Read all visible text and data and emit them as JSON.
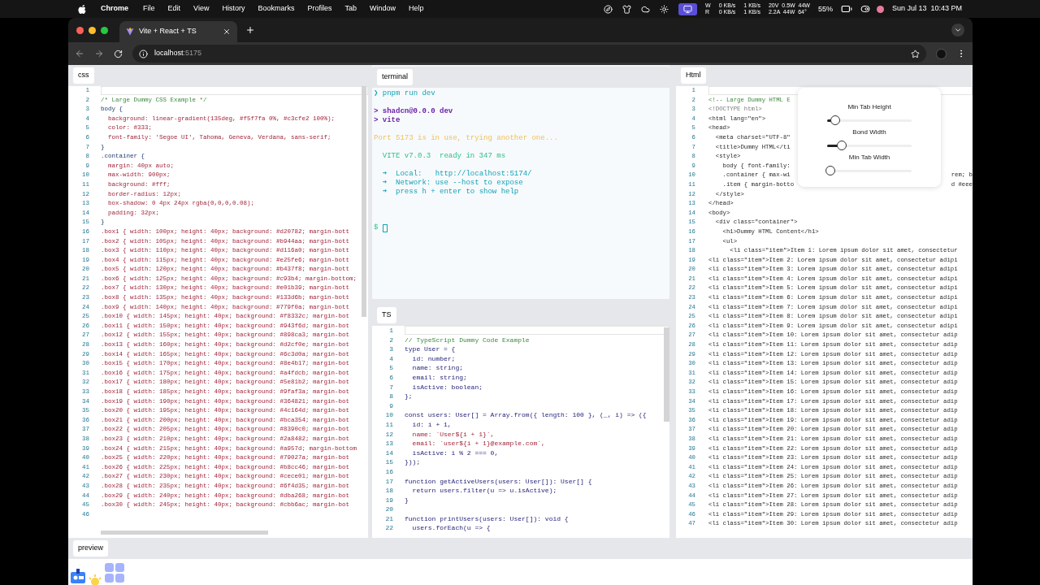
{
  "menubar": {
    "app": "Chrome",
    "items": [
      "File",
      "Edit",
      "View",
      "History",
      "Bookmarks",
      "Profiles",
      "Tab",
      "Window",
      "Help"
    ],
    "status": [
      {
        "kind": "stack",
        "lines": [
          "W",
          "R"
        ]
      },
      {
        "kind": "stack",
        "lines": [
          "0 KB/s",
          "0 KB/s"
        ]
      },
      {
        "kind": "stack",
        "lines": [
          "1 KB/s",
          "1 KB/s"
        ]
      },
      {
        "kind": "stack",
        "lines": [
          "20V  0.5W  44W",
          "2.2A  44W  64°"
        ]
      },
      {
        "kind": "text",
        "lines": [
          "55%"
        ]
      }
    ],
    "clock": "Sun Jul 13  10:43 PM"
  },
  "browser": {
    "tab_title": "Vite + React + TS",
    "url_host": "localhost",
    "url_port": ":5175"
  },
  "css_panel": {
    "tab": "css",
    "lines": [
      {
        "n": "1",
        "kind": "blank"
      },
      {
        "n": "2",
        "kind": "comment",
        "text": "/* Large Dummy CSS Example */"
      },
      {
        "n": "3",
        "kind": "selector",
        "text": "body {"
      },
      {
        "n": "4",
        "kind": "prop",
        "text": "  background: linear-gradient(135deg, #f5f7fa 0%, #c3cfe2 100%);"
      },
      {
        "n": "5",
        "kind": "prop",
        "text": "  color: #333;"
      },
      {
        "n": "6",
        "kind": "prop",
        "text": "  font-family: 'Segoe UI', Tahoma, Geneva, Verdana, sans-serif;"
      },
      {
        "n": "7",
        "kind": "selector",
        "text": "}"
      },
      {
        "n": "8",
        "kind": "selector",
        "text": ".container {"
      },
      {
        "n": "9",
        "kind": "prop",
        "text": "  margin: 40px auto;"
      },
      {
        "n": "10",
        "kind": "prop",
        "text": "  max-width: 900px;"
      },
      {
        "n": "11",
        "kind": "prop",
        "text": "  background: #fff;"
      },
      {
        "n": "12",
        "kind": "prop",
        "text": "  border-radius: 12px;"
      },
      {
        "n": "13",
        "kind": "prop",
        "text": "  box-shadow: 0 4px 24px rgba(0,0,0,0.08);"
      },
      {
        "n": "14",
        "kind": "prop",
        "text": "  padding: 32px;"
      },
      {
        "n": "15",
        "kind": "selector",
        "text": "}"
      },
      {
        "n": "16",
        "kind": "rule",
        "text": ".box1 { width: 100px; height: 40px; background: #d20782; margin-bott"
      },
      {
        "n": "17",
        "kind": "rule",
        "text": ".box2 { width: 105px; height: 40px; background: #b944aa; margin-bott"
      },
      {
        "n": "18",
        "kind": "rule",
        "text": ".box3 { width: 110px; height: 40px; background: #d116a0; margin-bott"
      },
      {
        "n": "19",
        "kind": "rule",
        "text": ".box4 { width: 115px; height: 40px; background: #e25fe6; margin-bott"
      },
      {
        "n": "20",
        "kind": "rule",
        "text": ".box5 { width: 120px; height: 40px; background: #b437f8; margin-bott"
      },
      {
        "n": "21",
        "kind": "rule",
        "text": ".box6 { width: 125px; height: 40px; background: #c93b4; margin-bottom;"
      },
      {
        "n": "22",
        "kind": "rule",
        "text": ".box7 { width: 130px; height: 40px; background: #e01b39; margin-bott"
      },
      {
        "n": "23",
        "kind": "rule",
        "text": ".box8 { width: 135px; height: 40px; background: #133d6b; margin-bott"
      },
      {
        "n": "24",
        "kind": "rule",
        "text": ".box9 { width: 140px; height: 40px; background: #779f0a; margin-bott"
      },
      {
        "n": "25",
        "kind": "rule",
        "text": ".box10 { width: 145px; height: 40px; background: #f8332c; margin-bot"
      },
      {
        "n": "26",
        "kind": "rule",
        "text": ".box11 { width: 150px; height: 40px; background: #943f6d; margin-bot"
      },
      {
        "n": "27",
        "kind": "rule",
        "text": ".box12 { width: 155px; height: 40px; background: #898ca3; margin-bot"
      },
      {
        "n": "28",
        "kind": "rule",
        "text": ".box13 { width: 160px; height: 40px; background: #d2cf0e; margin-bot"
      },
      {
        "n": "29",
        "kind": "rule",
        "text": ".box14 { width: 165px; height: 40px; background: #6c3d0a; margin-bot"
      },
      {
        "n": "30",
        "kind": "rule",
        "text": ".box15 { width: 170px; height: 40px; background: #8e4b17; margin-bot"
      },
      {
        "n": "31",
        "kind": "rule",
        "text": ".box16 { width: 175px; height: 40px; background: #a4fdcb; margin-bot"
      },
      {
        "n": "32",
        "kind": "rule",
        "text": ".box17 { width: 180px; height: 40px; background: #5e81b2; margin-bot"
      },
      {
        "n": "33",
        "kind": "rule",
        "text": ".box18 { width: 185px; height: 40px; background: #9faf3a; margin-bot"
      },
      {
        "n": "34",
        "kind": "rule",
        "text": ".box19 { width: 190px; height: 40px; background: #364821; margin-bot"
      },
      {
        "n": "35",
        "kind": "rule",
        "text": ".box20 { width: 195px; height: 40px; background: #4c164d; margin-bot"
      },
      {
        "n": "36",
        "kind": "rule",
        "text": ".box21 { width: 200px; height: 40px; background: #bca354; margin-bot"
      },
      {
        "n": "37",
        "kind": "rule",
        "text": ".box22 { width: 205px; height: 40px; background: #8390c0; margin-bot"
      },
      {
        "n": "38",
        "kind": "rule",
        "text": ".box23 { width: 210px; height: 40px; background: #2a8482; margin-bot"
      },
      {
        "n": "39",
        "kind": "rule",
        "text": ".box24 { width: 215px; height: 40px; background: #a957d; margin-bottom"
      },
      {
        "n": "40",
        "kind": "rule",
        "text": ".box25 { width: 220px; height: 40px; background: #79027a; margin-bot"
      },
      {
        "n": "41",
        "kind": "rule",
        "text": ".box26 { width: 225px; height: 40px; background: #b8cc46; margin-bot"
      },
      {
        "n": "42",
        "kind": "rule",
        "text": ".box27 { width: 230px; height: 40px; background: #cece01; margin-bot"
      },
      {
        "n": "43",
        "kind": "rule",
        "text": ".box28 { width: 235px; height: 40px; background: #6f4d35; margin-bot"
      },
      {
        "n": "44",
        "kind": "rule",
        "text": ".box29 { width: 240px; height: 40px; background: #dba268; margin-bot"
      },
      {
        "n": "45",
        "kind": "rule",
        "text": ".box30 { width: 245px; height: 40px; background: #cbb6ac; margin-bot"
      },
      {
        "n": "46",
        "kind": "blank"
      }
    ]
  },
  "terminal_panel": {
    "tab": "terminal",
    "lines": [
      {
        "kind": "prompt",
        "text": "❯ pnpm run dev"
      },
      {
        "kind": "blank"
      },
      {
        "kind": "script",
        "text": "> shadcn@0.0.0 dev"
      },
      {
        "kind": "script",
        "text": "> vite"
      },
      {
        "kind": "blank"
      },
      {
        "kind": "warn",
        "text": "Port 5173 is in use, trying another one..."
      },
      {
        "kind": "blank"
      },
      {
        "kind": "vite",
        "text": "  VITE v7.0.3  ready in 347 ms"
      },
      {
        "kind": "blank"
      },
      {
        "kind": "info",
        "text": "  ➜  Local:   http://localhost:5174/"
      },
      {
        "kind": "info",
        "text": "  ➜  Network: use --host to expose"
      },
      {
        "kind": "info",
        "text": "  ➜  press h + enter to show help"
      },
      {
        "kind": "blank"
      },
      {
        "kind": "blank"
      },
      {
        "kind": "blank"
      },
      {
        "kind": "shell",
        "text": "$"
      }
    ]
  },
  "ts_panel": {
    "tab": "TS",
    "lines": [
      {
        "n": "1",
        "kind": "blank"
      },
      {
        "n": "2",
        "kind": "comment",
        "text": "// TypeScript Dummy Code Example"
      },
      {
        "n": "3",
        "kind": "code",
        "text": "type User = {"
      },
      {
        "n": "4",
        "kind": "code",
        "text": "  id: number;"
      },
      {
        "n": "5",
        "kind": "code",
        "text": "  name: string;"
      },
      {
        "n": "6",
        "kind": "code",
        "text": "  email: string;"
      },
      {
        "n": "7",
        "kind": "code",
        "text": "  isActive: boolean;"
      },
      {
        "n": "8",
        "kind": "code",
        "text": "};"
      },
      {
        "n": "9",
        "kind": "blank"
      },
      {
        "n": "10",
        "kind": "code",
        "text": "const users: User[] = Array.from({ length: 100 }, (_, i) => ({"
      },
      {
        "n": "11",
        "kind": "code",
        "text": "  id: i + 1,"
      },
      {
        "n": "12",
        "kind": "string",
        "text": "  name: `User${i + 1}`,"
      },
      {
        "n": "13",
        "kind": "string",
        "text": "  email: `user${i + 1}@example.com`,"
      },
      {
        "n": "14",
        "kind": "code",
        "text": "  isActive: i % 2 === 0,"
      },
      {
        "n": "15",
        "kind": "code",
        "text": "}));"
      },
      {
        "n": "16",
        "kind": "blank"
      },
      {
        "n": "17",
        "kind": "code",
        "text": "function getActiveUsers(users: User[]): User[] {"
      },
      {
        "n": "18",
        "kind": "code",
        "text": "  return users.filter(u => u.isActive);"
      },
      {
        "n": "19",
        "kind": "code",
        "text": "}"
      },
      {
        "n": "20",
        "kind": "blank"
      },
      {
        "n": "21",
        "kind": "code",
        "text": "function printUsers(users: User[]): void {"
      },
      {
        "n": "22",
        "kind": "code",
        "text": "  users.forEach(u => {"
      }
    ]
  },
  "html_panel": {
    "tab": "Html",
    "lines": [
      {
        "n": "1",
        "kind": "blank"
      },
      {
        "n": "2",
        "kind": "comment",
        "text": "<!-- Large Dummy HTML E"
      },
      {
        "n": "3",
        "kind": "doctype",
        "text": "<!DOCTYPE html>"
      },
      {
        "n": "4",
        "kind": "tag",
        "text": "<html lang=\"en\">"
      },
      {
        "n": "5",
        "kind": "tag",
        "text": "<head>"
      },
      {
        "n": "6",
        "kind": "tag",
        "text": "  <meta charset=\"UTF-8\""
      },
      {
        "n": "7",
        "kind": "tag",
        "text": "  <title>Dummy HTML</ti"
      },
      {
        "n": "8",
        "kind": "tag",
        "text": "  <style>"
      },
      {
        "n": "9",
        "kind": "tag",
        "text": "    body { font-family:"
      },
      {
        "n": "10",
        "kind": "tag",
        "text": "    .container { max-wi",
        "tail": "rem; b"
      },
      {
        "n": "11",
        "kind": "tag",
        "text": "    .item { margin-botto",
        "tail": "d #eee"
      },
      {
        "n": "12",
        "kind": "tag",
        "text": "  </style>"
      },
      {
        "n": "13",
        "kind": "tag",
        "text": "</head>"
      },
      {
        "n": "14",
        "kind": "tag",
        "text": "<body>"
      },
      {
        "n": "15",
        "kind": "tag",
        "text": "  <div class=\"container\">"
      },
      {
        "n": "16",
        "kind": "tag",
        "text": "    <h1>Dummy HTML Content</h1>"
      },
      {
        "n": "17",
        "kind": "tag",
        "text": "    <ul>"
      },
      {
        "n": "18",
        "kind": "tag",
        "text": "      <li class=\"item\">Item 1: Lorem ipsum dolor sit amet, consectetur"
      },
      {
        "n": "19",
        "kind": "tag",
        "text": "<li class=\"item\">Item 2: Lorem ipsum dolor sit amet, consectetur adipi"
      },
      {
        "n": "20",
        "kind": "tag",
        "text": "<li class=\"item\">Item 3: Lorem ipsum dolor sit amet, consectetur adipi"
      },
      {
        "n": "21",
        "kind": "tag",
        "text": "<li class=\"item\">Item 4: Lorem ipsum dolor sit amet, consectetur adipi"
      },
      {
        "n": "22",
        "kind": "tag",
        "text": "<li class=\"item\">Item 5: Lorem ipsum dolor sit amet, consectetur adipi"
      },
      {
        "n": "23",
        "kind": "tag",
        "text": "<li class=\"item\">Item 6: Lorem ipsum dolor sit amet, consectetur adipi"
      },
      {
        "n": "24",
        "kind": "tag",
        "text": "<li class=\"item\">Item 7: Lorem ipsum dolor sit amet, consectetur adipi"
      },
      {
        "n": "25",
        "kind": "tag",
        "text": "<li class=\"item\">Item 8: Lorem ipsum dolor sit amet, consectetur adipi"
      },
      {
        "n": "26",
        "kind": "tag",
        "text": "<li class=\"item\">Item 9: Lorem ipsum dolor sit amet, consectetur adipi"
      },
      {
        "n": "27",
        "kind": "tag",
        "text": "<li class=\"item\">Item 10: Lorem ipsum dolor sit amet, consectetur adip"
      },
      {
        "n": "28",
        "kind": "tag",
        "text": "<li class=\"item\">Item 11: Lorem ipsum dolor sit amet, consectetur adip"
      },
      {
        "n": "29",
        "kind": "tag",
        "text": "<li class=\"item\">Item 12: Lorem ipsum dolor sit amet, consectetur adip"
      },
      {
        "n": "30",
        "kind": "tag",
        "text": "<li class=\"item\">Item 13: Lorem ipsum dolor sit amet, consectetur adip"
      },
      {
        "n": "31",
        "kind": "tag",
        "text": "<li class=\"item\">Item 14: Lorem ipsum dolor sit amet, consectetur adip"
      },
      {
        "n": "32",
        "kind": "tag",
        "text": "<li class=\"item\">Item 15: Lorem ipsum dolor sit amet, consectetur adip"
      },
      {
        "n": "33",
        "kind": "tag",
        "text": "<li class=\"item\">Item 16: Lorem ipsum dolor sit amet, consectetur adip"
      },
      {
        "n": "34",
        "kind": "tag",
        "text": "<li class=\"item\">Item 17: Lorem ipsum dolor sit amet, consectetur adip"
      },
      {
        "n": "35",
        "kind": "tag",
        "text": "<li class=\"item\">Item 18: Lorem ipsum dolor sit amet, consectetur adip"
      },
      {
        "n": "36",
        "kind": "tag",
        "text": "<li class=\"item\">Item 19: Lorem ipsum dolor sit amet, consectetur adip"
      },
      {
        "n": "37",
        "kind": "tag",
        "text": "<li class=\"item\">Item 20: Lorem ipsum dolor sit amet, consectetur adip"
      },
      {
        "n": "38",
        "kind": "tag",
        "text": "<li class=\"item\">Item 21: Lorem ipsum dolor sit amet, consectetur adip"
      },
      {
        "n": "39",
        "kind": "tag",
        "text": "<li class=\"item\">Item 22: Lorem ipsum dolor sit amet, consectetur adip"
      },
      {
        "n": "40",
        "kind": "tag",
        "text": "<li class=\"item\">Item 23: Lorem ipsum dolor sit amet, consectetur adip"
      },
      {
        "n": "41",
        "kind": "tag",
        "text": "<li class=\"item\">Item 24: Lorem ipsum dolor sit amet, consectetur adip"
      },
      {
        "n": "42",
        "kind": "tag",
        "text": "<li class=\"item\">Item 25: Lorem ipsum dolor sit amet, consectetur adip"
      },
      {
        "n": "43",
        "kind": "tag",
        "text": "<li class=\"item\">Item 26: Lorem ipsum dolor sit amet, consectetur adip"
      },
      {
        "n": "44",
        "kind": "tag",
        "text": "<li class=\"item\">Item 27: Lorem ipsum dolor sit amet, consectetur adip"
      },
      {
        "n": "45",
        "kind": "tag",
        "text": "<li class=\"item\">Item 28: Lorem ipsum dolor sit amet, consectetur adip"
      },
      {
        "n": "46",
        "kind": "tag",
        "text": "<li class=\"item\">Item 29: Lorem ipsum dolor sit amet, consectetur adip"
      },
      {
        "n": "47",
        "kind": "tag",
        "text": "<li class=\"item\">Item 30: Lorem ipsum dolor sit amet, consectetur adip"
      }
    ],
    "settings": [
      {
        "label": "Min Tab Height",
        "level": 0.06
      },
      {
        "label": "Bond Width",
        "level": 0.13
      },
      {
        "label": "Min Tab Width",
        "level": 0.0
      }
    ]
  },
  "preview_panel": {
    "tab": "preview"
  }
}
